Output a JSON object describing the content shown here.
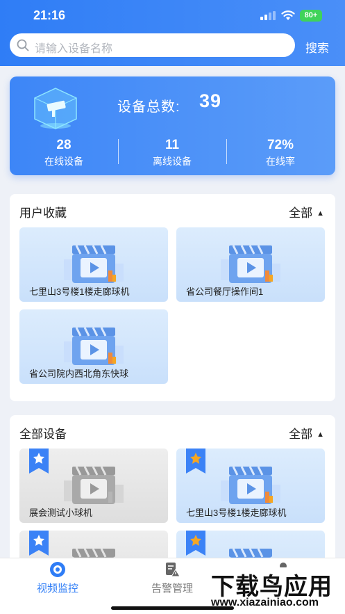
{
  "status": {
    "time": "21:16",
    "battery": "80+"
  },
  "search": {
    "placeholder": "请输入设备名称",
    "button": "搜索"
  },
  "stats": {
    "total_label": "设备总数:",
    "total_value": "39",
    "items": [
      {
        "value": "28",
        "label": "在线设备"
      },
      {
        "value": "11",
        "label": "离线设备"
      },
      {
        "value": "72%",
        "label": "在线率"
      }
    ]
  },
  "favorites": {
    "title": "用户收藏",
    "filter": "全部",
    "devices": [
      {
        "name": "七里山3号楼1楼走廊球机"
      },
      {
        "name": "省公司餐厅操作间1"
      },
      {
        "name": "省公司院内西北角东快球"
      }
    ]
  },
  "all_devices": {
    "title": "全部设备",
    "filter": "全部",
    "devices": [
      {
        "name": "展会测试小球机",
        "online": false,
        "starred": false
      },
      {
        "name": "七里山3号楼1楼走廊球机",
        "online": true,
        "starred": true
      },
      {
        "name": "",
        "online": false,
        "starred": false
      },
      {
        "name": "",
        "online": true,
        "starred": true
      }
    ]
  },
  "nav": {
    "items": [
      {
        "label": "视频监控",
        "icon": "camera-eye-icon",
        "active": true
      },
      {
        "label": "告警管理",
        "icon": "alert-doc-icon",
        "active": false
      },
      {
        "label": "",
        "icon": "user-icon",
        "active": false
      }
    ]
  },
  "watermark": {
    "title": "下载鸟应用",
    "url": "www.xiazainiao.com"
  },
  "colors": {
    "primary": "#2f7df6",
    "star_active": "#f5a623",
    "badge_bg": "#3b82f6"
  }
}
